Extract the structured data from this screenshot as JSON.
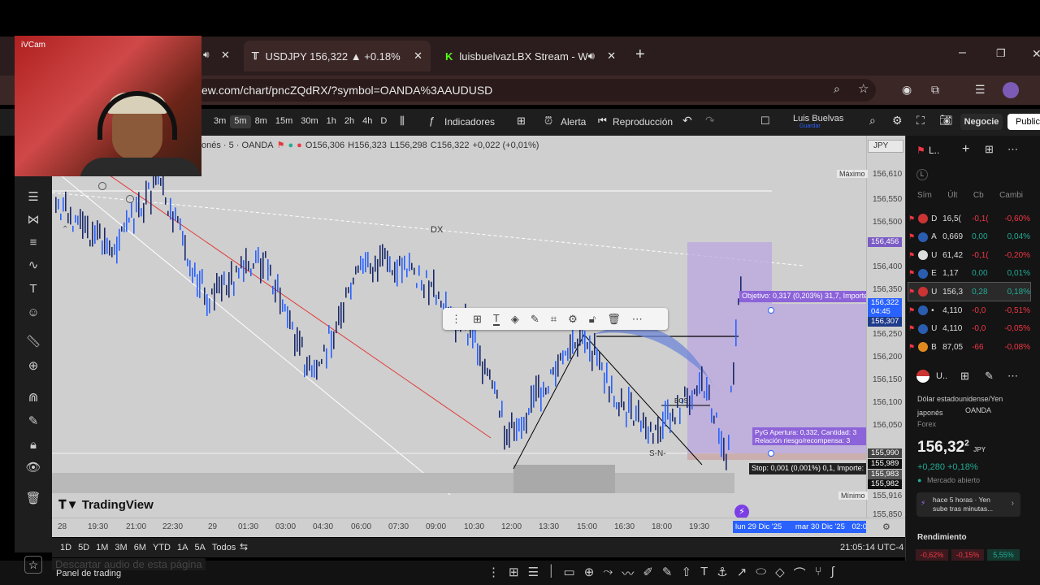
{
  "browser": {
    "tabs": [
      {
        "label": "USDJPY 156,322 ▲ +0.18%",
        "active": true
      },
      {
        "label": "luisbuelvazLBX Stream - W",
        "active": false
      }
    ],
    "url": "ew.com/chart/pncZQdRX/?symbol=OANDA%3AAUDUSD"
  },
  "webcam": {
    "label": "iVCam"
  },
  "toolbar": {
    "intervals": [
      "3m",
      "5m",
      "8m",
      "15m",
      "30m",
      "1h",
      "2h",
      "4h",
      "D"
    ],
    "active_interval": "5m",
    "indicators": "Indicadores",
    "alert": "Alerta",
    "replay": "Reproducción",
    "user": "Luis Buelvas",
    "user_sub": "Guardar",
    "trade": "Negocie",
    "publish": "Publica"
  },
  "legend": {
    "symbol": "onés · 5 · OANDA",
    "o": "O156,306",
    "h": "H156,323",
    "l": "L156,298",
    "c": "C156,322",
    "chg": "+0,022 (+0,01%)"
  },
  "chart": {
    "currency": "JPY",
    "max_label": "Máximo",
    "max_value": "156,610",
    "min_label": "Mínimo",
    "min_value": "155,916",
    "price_ticks": [
      "156,550",
      "156,500",
      "156,400",
      "156,350",
      "156,250",
      "156,200",
      "156,150",
      "156,100",
      "156,050",
      "155,850"
    ],
    "price_badges": [
      {
        "value": "156,456",
        "color": "#7a5cc4"
      },
      {
        "value": "156,322",
        "color": "#2962ff"
      },
      {
        "value": "04:45",
        "color": "#2962ff"
      },
      {
        "value": "156,307",
        "color": "#1e3a8a"
      },
      {
        "value": "155,990",
        "color": "#444"
      },
      {
        "value": "155,989",
        "color": "#111"
      },
      {
        "value": "155,983",
        "color": "#555"
      },
      {
        "value": "155,982",
        "color": "#111"
      }
    ],
    "time_ticks": [
      "28",
      "19:30",
      "21:00",
      "22:30",
      "29",
      "01:30",
      "03:00",
      "04:30",
      "06:00",
      "07:30",
      "09:00",
      "10:30",
      "12:00",
      "13:30",
      "15:00",
      "16:30",
      "18:00",
      "19:30"
    ],
    "time_range": {
      "start": "lun 29 Dic '25",
      "end": "mar 30 Dic '25",
      "end_time": "02:05"
    },
    "labels": {
      "dx": "DX",
      "bos": "BOS",
      "sn": "S-N-"
    },
    "target": "Objetivo: 0,317 (0,203%) 31,7, Importe",
    "pnl1": "PyG Apertura: 0,332, Cantidad: 3",
    "pnl2": "Relación riesgo/recompensa: 3",
    "stop": "Stop: 0,001 (0,001%) 0,1, Importe:",
    "brand": "TradingView",
    "clock": "21:05:14 UTC-4"
  },
  "ranges": [
    "1D",
    "5D",
    "1M",
    "3M",
    "6M",
    "YTD",
    "1A",
    "5A",
    "Todos"
  ],
  "bottom": {
    "panel": "Panel de trading",
    "ghost": "Descartar audio de esta página"
  },
  "watchlist": {
    "title": "L..",
    "cols": [
      "Sím",
      "Últ",
      "Cb",
      "Cambi"
    ],
    "rows": [
      {
        "sym": "D",
        "last": "16,5(",
        "chg": "-0,1(",
        "pct": "-0,60%",
        "neg": true
      },
      {
        "sym": "A",
        "last": "0,669",
        "chg": "0,00",
        "pct": "0,04%",
        "neg": false
      },
      {
        "sym": "U",
        "last": "61,42",
        "chg": "-0,1(",
        "pct": "-0,20%",
        "neg": true
      },
      {
        "sym": "E",
        "last": "1,17",
        "chg": "0,00",
        "pct": "0,01%",
        "neg": false
      },
      {
        "sym": "U",
        "last": "156,3",
        "chg": "0,28",
        "pct": "0,18%",
        "neg": false
      },
      {
        "sym": "•",
        "last": "4,110",
        "chg": "-0,0",
        "pct": "-0,51%",
        "neg": true
      },
      {
        "sym": "U",
        "last": "4,110",
        "chg": "-0,0",
        "pct": "-0,05%",
        "neg": true
      },
      {
        "sym": "B",
        "last": "87,05",
        "chg": "-66",
        "pct": "-0,08%",
        "neg": true
      }
    ]
  },
  "detail": {
    "sym": "U..",
    "name": "Dólar estadounidense/Yen japonés",
    "exchange": "OANDA",
    "type": "Forex",
    "price": "156,32",
    "price_sup": "2",
    "currency": "JPY",
    "change": "+0,280 +0,18%",
    "status": "Mercado abierto",
    "news": "hace 5 horas · Yen sube tras minutas...",
    "perf_label": "Rendimiento",
    "perf": [
      "-0,62%",
      "-0,15%",
      "5,55%"
    ]
  }
}
